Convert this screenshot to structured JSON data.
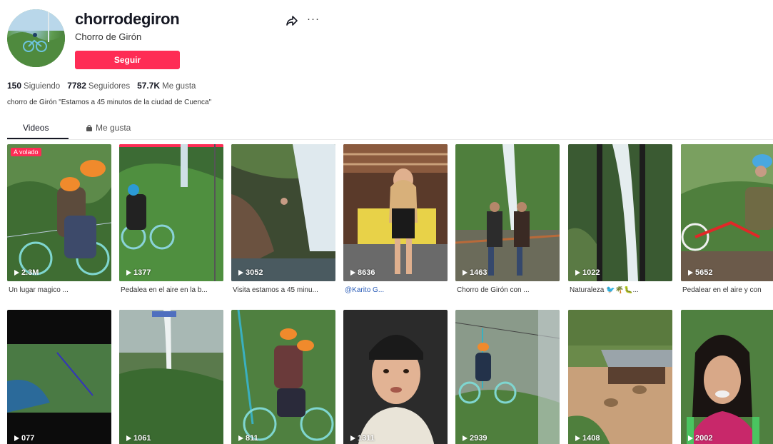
{
  "profile": {
    "username": "chorrodegiron",
    "nickname": "Chorro de Girón",
    "follow_label": "Seguir",
    "stats": [
      {
        "value": "150",
        "label": "Siguiendo"
      },
      {
        "value": "7782",
        "label": "Seguidores"
      },
      {
        "value": "57.7K",
        "label": "Me gusta"
      }
    ],
    "bio": "chorro de Girón \"Estamos a 45 minutos de la ciudad de Cuenca\""
  },
  "tabs": [
    {
      "label": "Videos"
    },
    {
      "label": "Me gusta"
    }
  ],
  "videos": [
    {
      "views": "2.3M",
      "caption": "Un lugar magico ...",
      "badge": "A volado"
    },
    {
      "views": "1377",
      "caption": "Pedalea en el aire en la b..."
    },
    {
      "views": "3052",
      "caption": "Visita estamos a 45 minu..."
    },
    {
      "views": "8636",
      "caption": "@Karito G..."
    },
    {
      "views": "1463",
      "caption": "Chorro de Girón con ..."
    },
    {
      "views": "1022",
      "caption": "Naturaleza 🐦🌴🐛..."
    },
    {
      "views": "5652",
      "caption": "Pedalear en el aire y con"
    },
    {
      "views": "077",
      "caption": ""
    },
    {
      "views": "1061",
      "caption": ""
    },
    {
      "views": "811",
      "caption": ""
    },
    {
      "views": "1311",
      "caption": ""
    },
    {
      "views": "2939",
      "caption": ""
    },
    {
      "views": "1408",
      "caption": ""
    },
    {
      "views": "2002",
      "caption": ""
    }
  ],
  "colors": {
    "accent": "#fe2c55",
    "text": "#161823"
  }
}
